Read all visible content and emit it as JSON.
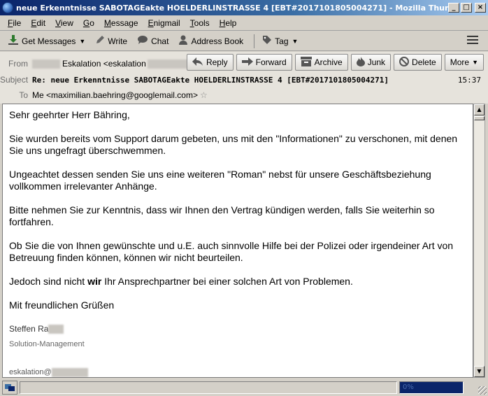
{
  "window": {
    "title": "neue Erkenntnisse SABOTAGEakte HOELDERLINSTRASSE 4 [EBT#2017101805004271] - Mozilla Thunderbird",
    "minimize": "_",
    "maximize": "□",
    "close": "×"
  },
  "menu": [
    {
      "label": "File"
    },
    {
      "label": "Edit"
    },
    {
      "label": "View"
    },
    {
      "label": "Go"
    },
    {
      "label": "Message"
    },
    {
      "label": "Enigmail"
    },
    {
      "label": "Tools"
    },
    {
      "label": "Help"
    }
  ],
  "toolbar": {
    "get_messages": "Get Messages",
    "write": "Write",
    "chat": "Chat",
    "address_book": "Address Book",
    "tag": "Tag"
  },
  "header": {
    "from_label": "From",
    "from_value": "Eskalation <eskalation",
    "subject_label": "Subject",
    "subject": "Re: neue Erkenntnisse SABOTAGEakte HOELDERLINSTRASSE 4 [EBT#2017101805004271]",
    "time": "15:37",
    "to_label": "To",
    "to_value": "Me <maximilian.baehring@googlemail.com>"
  },
  "actions": {
    "reply": "Reply",
    "forward": "Forward",
    "archive": "Archive",
    "junk": "Junk",
    "delete": "Delete",
    "more": "More"
  },
  "body": {
    "greeting": "Sehr geehrter Herr Bähring,",
    "p1": "Sie wurden bereits vom Support darum gebeten, uns mit den \"Informationen\" zu verschonen, mit denen Sie uns ungefragt überschwemmen.",
    "p2": "Ungeachtet dessen senden Sie uns eine weiteren \"Roman\" nebst für unsere Geschäftsbeziehung vollkommen irrelevanter Anhänge.",
    "p3": "Bitte nehmen Sie zur Kenntnis, dass wir Ihnen den Vertrag kündigen werden, falls Sie weiterhin so fortfahren.",
    "p4": "Ob Sie die von Ihnen gewünschte und u.E. auch sinnvolle Hilfe bei der Polizei oder irgendeiner Art von Betreuung finden können, können wir nicht beurteilen.",
    "p5_pre": "Jedoch sind nicht ",
    "p5_bold": "wir",
    "p5_post": " Ihr Ansprechpartner bei einer solchen Art von Problemen.",
    "closing": "Mit freundlichen Grüßen",
    "sig_name": "Steffen Ra",
    "sig_role": "Solution-Management",
    "sig_mail": "eskalation@"
  },
  "status": {
    "progress_text": "0%"
  }
}
